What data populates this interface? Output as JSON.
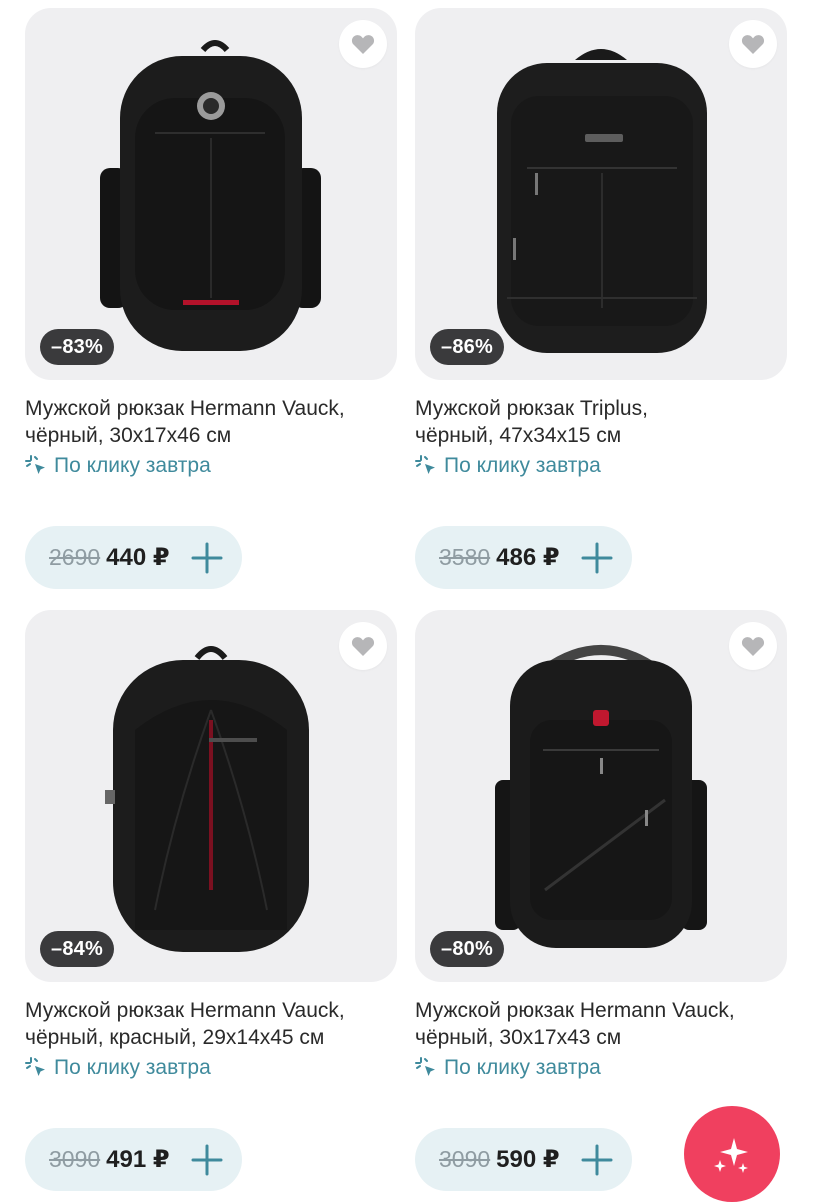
{
  "accent_color": "#3f8a9c",
  "fab_color": "#f0405f",
  "products": [
    {
      "badge": "–83%",
      "title_line1": "Мужской рюкзак Hermann Vauck,",
      "title_line2": "чёрный, 30x17x46 см",
      "delivery": "По клику завтра",
      "old_price": "2690",
      "price": "440 ₽",
      "favorite_icon": "heart-icon",
      "add_icon": "plus-icon"
    },
    {
      "badge": "–86%",
      "title_line1": "Мужской рюкзак Triplus,",
      "title_line2": "чёрный, 47x34x15 см",
      "delivery": "По клику завтра",
      "old_price": "3580",
      "price": "486 ₽",
      "favorite_icon": "heart-icon",
      "add_icon": "plus-icon"
    },
    {
      "badge": "–84%",
      "title_line1": "Мужской рюкзак Hermann Vauck,",
      "title_line2": "чёрный, красный, 29x14x45 см",
      "delivery": "По клику завтра",
      "old_price": "3090",
      "price": "491 ₽",
      "favorite_icon": "heart-icon",
      "add_icon": "plus-icon"
    },
    {
      "badge": "–80%",
      "title_line1": "Мужской рюкзак Hermann Vauck,",
      "title_line2": "чёрный, 30x17x43 см",
      "delivery": "По клику завтра",
      "old_price": "3090",
      "price": "590 ₽",
      "favorite_icon": "heart-icon",
      "add_icon": "plus-icon"
    }
  ],
  "fab": {
    "icon": "sparkles-icon"
  }
}
